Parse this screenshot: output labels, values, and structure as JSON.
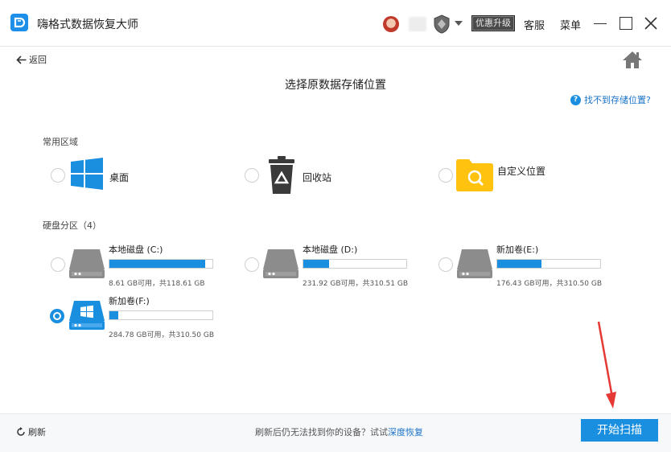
{
  "titlebar": {
    "app_title": "嗨格式数据恢复大师",
    "promo_label": "优惠升级",
    "service_label": "客服",
    "menu_label": "菜单"
  },
  "nav": {
    "back_label": "返回"
  },
  "page": {
    "title": "选择原数据存储位置",
    "help_text": "找不到存储位置?"
  },
  "common": {
    "section_label": "常用区域",
    "items": [
      {
        "label": "桌面",
        "icon": "windows-desktop-icon",
        "selected": false
      },
      {
        "label": "回收站",
        "icon": "recycle-bin-icon",
        "selected": false
      },
      {
        "label": "自定义位置",
        "icon": "folder-search-icon",
        "selected": false
      }
    ]
  },
  "disks": {
    "section_label": "硬盘分区（4）",
    "items": [
      {
        "name": "本地磁盘 (C:)",
        "capacity": "8.61 GB可用，共118.61 GB",
        "used_fraction": 0.927,
        "selected": false
      },
      {
        "name": "本地磁盘 (D:)",
        "capacity": "231.92 GB可用，共310.51 GB",
        "used_fraction": 0.253,
        "selected": false
      },
      {
        "name": "新加卷(E:)",
        "capacity": "176.43 GB可用，共310.50 GB",
        "used_fraction": 0.432,
        "selected": false
      },
      {
        "name": "新加卷(F:)",
        "capacity": "284.78 GB可用，共310.50 GB",
        "used_fraction": 0.083,
        "selected": true
      }
    ]
  },
  "footer": {
    "refresh_label": "刷新",
    "tip_text": "刷新后仍无法找到你的设备？试试",
    "tip_link": "深度恢复",
    "start_label": "开始扫描"
  },
  "colors": {
    "accent": "#1a8fe0",
    "link": "#1a73c8",
    "annotation_arrow": "#e53935"
  }
}
